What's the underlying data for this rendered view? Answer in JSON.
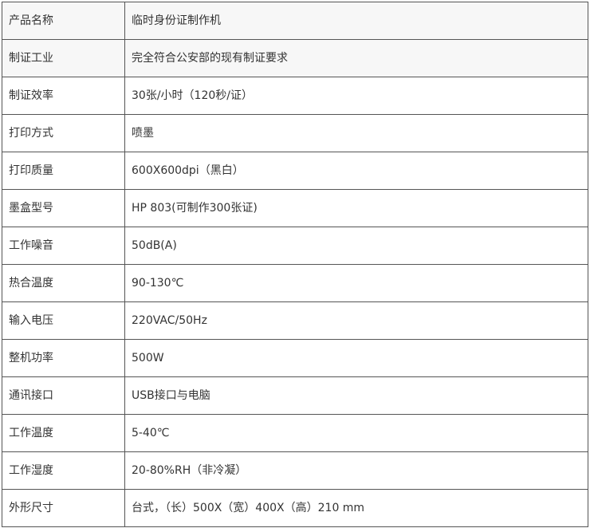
{
  "spec_table": {
    "rows": [
      {
        "label": "产品名称",
        "value": "临时身份证制作机"
      },
      {
        "label": "制证工业",
        "value": "完全符合公安部的现有制证要求"
      },
      {
        "label": "制证效率",
        "value": "30张/小时（120秒/证）"
      },
      {
        "label": "打印方式",
        "value": "喷墨"
      },
      {
        "label": "打印质量",
        "value": "600X600dpi（黑白）"
      },
      {
        "label": "墨盒型号",
        "value": "HP 803(可制作300张证)"
      },
      {
        "label": "工作噪音",
        "value": "50dB(A)"
      },
      {
        "label": "热合温度",
        "value": "90-130℃"
      },
      {
        "label": "输入电压",
        "value": "220VAC/50Hz"
      },
      {
        "label": "整机功率",
        "value": "500W"
      },
      {
        "label": "通讯接口",
        "value": "USB接口与电脑"
      },
      {
        "label": "工作温度",
        "value": "5-40℃"
      },
      {
        "label": "工作湿度",
        "value": "20-80%RH（非冷凝）"
      },
      {
        "label": "外形尺寸",
        "value": "台式，（长）500X（宽）400X（高）210 mm"
      }
    ]
  }
}
